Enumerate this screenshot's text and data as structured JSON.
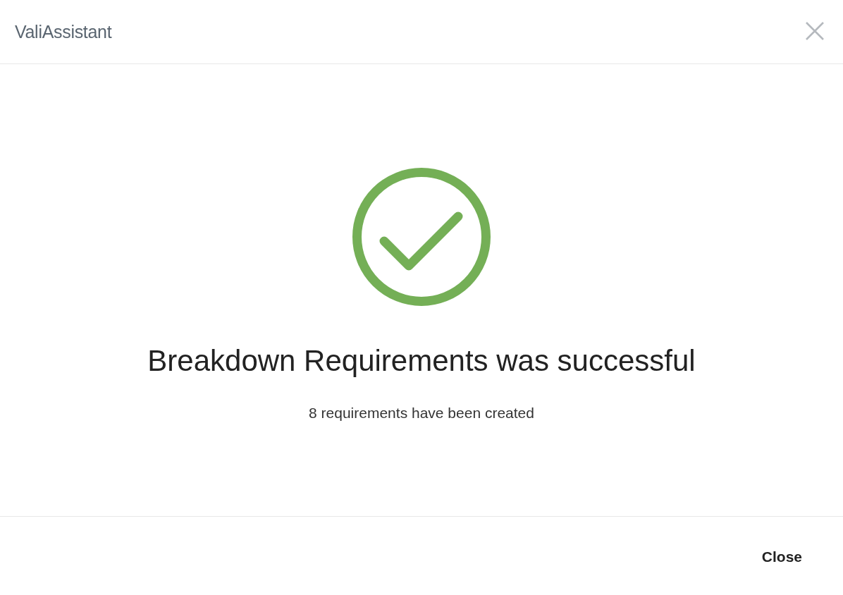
{
  "dialog": {
    "title": "ValiAssistant",
    "message": {
      "kind": "success",
      "heading": "Breakdown Requirements was successful",
      "detail": "8 requirements have been created"
    },
    "buttons": [
      {
        "label": "Close"
      }
    ]
  }
}
